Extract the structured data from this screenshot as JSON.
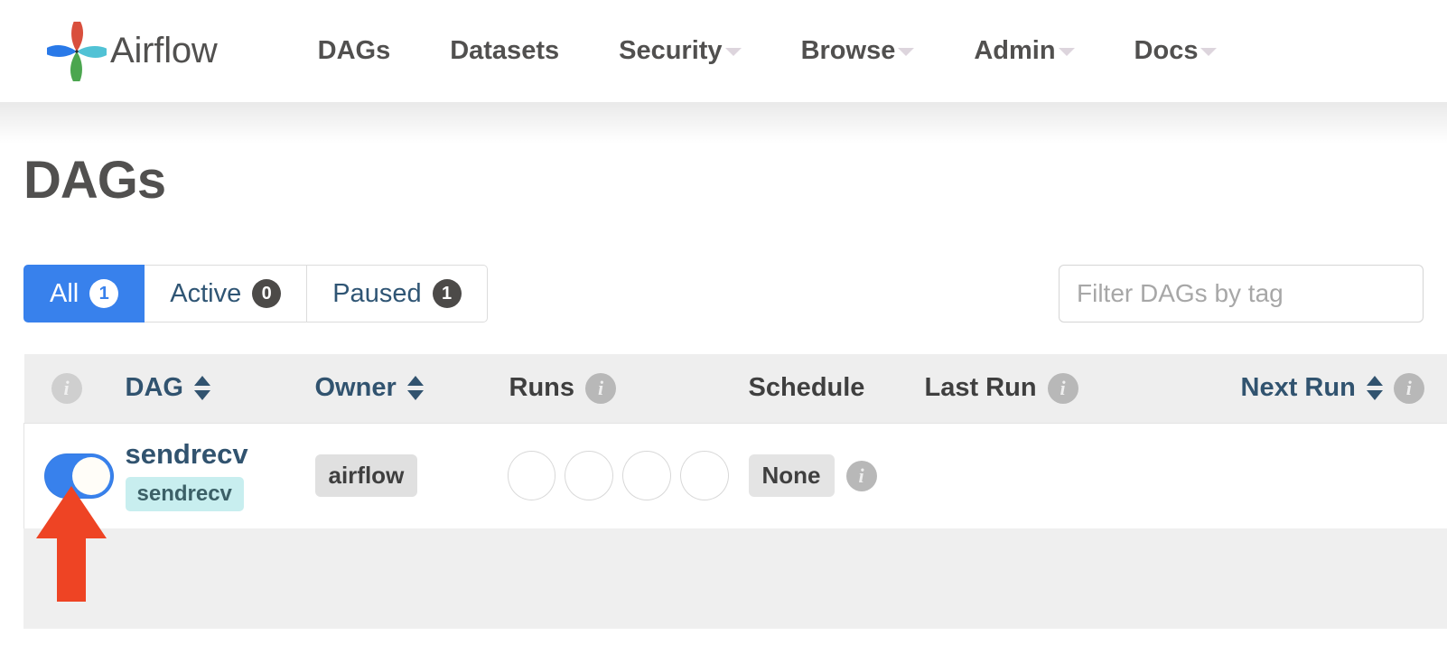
{
  "navbar": {
    "brand_label": "Airflow",
    "brand_logo_icon": "airflow-pinwheel-logo",
    "links": [
      {
        "label": "DAGs",
        "has_caret": false,
        "icon": ""
      },
      {
        "label": "Datasets",
        "has_caret": false,
        "icon": ""
      },
      {
        "label": "Security",
        "has_caret": true,
        "icon": "chevron-down-icon"
      },
      {
        "label": "Browse",
        "has_caret": true,
        "icon": "chevron-down-icon"
      },
      {
        "label": "Admin",
        "has_caret": true,
        "icon": "chevron-down-icon"
      },
      {
        "label": "Docs",
        "has_caret": true,
        "icon": "chevron-down-icon"
      }
    ]
  },
  "page": {
    "title": "DAGs"
  },
  "filters": {
    "tabs": [
      {
        "label": "All",
        "count": "1",
        "active": true
      },
      {
        "label": "Active",
        "count": "0",
        "active": false
      },
      {
        "label": "Paused",
        "count": "1",
        "active": false
      }
    ],
    "tag_filter": {
      "value": "",
      "placeholder": "Filter DAGs by tag"
    }
  },
  "table": {
    "columns": [
      {
        "key": "toggle",
        "label": "",
        "sortable": false,
        "info": true,
        "link": false,
        "info_icon": "info-icon"
      },
      {
        "key": "dag",
        "label": "DAG",
        "sortable": true,
        "info": false,
        "link": true,
        "sort_icon": "sort-arrows-icon"
      },
      {
        "key": "owner",
        "label": "Owner",
        "sortable": true,
        "info": false,
        "link": true,
        "sort_icon": "sort-arrows-icon"
      },
      {
        "key": "runs",
        "label": "Runs",
        "sortable": false,
        "info": true,
        "link": false,
        "info_icon": "info-icon"
      },
      {
        "key": "schedule",
        "label": "Schedule",
        "sortable": false,
        "info": false,
        "link": false
      },
      {
        "key": "last_run",
        "label": "Last Run",
        "sortable": false,
        "info": true,
        "link": false,
        "info_icon": "info-icon"
      },
      {
        "key": "next_run",
        "label": "Next Run",
        "sortable": true,
        "info": true,
        "link": true,
        "sort_icon": "sort-arrows-icon",
        "info_icon": "info-icon"
      }
    ],
    "rows": [
      {
        "paused_toggle": {
          "state": "on",
          "icon": "toggle-switch-on-icon"
        },
        "dag_id": "sendrecv",
        "tags": [
          "sendrecv"
        ],
        "owner": "airflow",
        "runs_circles": 4,
        "schedule": "None",
        "last_run": "",
        "next_run": ""
      }
    ]
  },
  "annotation": {
    "arrow_color": "#ee4424",
    "arrow_icon": "arrow-up-annotation",
    "points_at": "pause-unpause-toggle"
  },
  "colors": {
    "accent_blue": "#3881ec",
    "link_blue": "#31536f",
    "tag_teal": "#c8eeef",
    "badge_gray": "#4c4a48",
    "header_gray": "#eeeeee",
    "strip_gray": "#efefef"
  }
}
